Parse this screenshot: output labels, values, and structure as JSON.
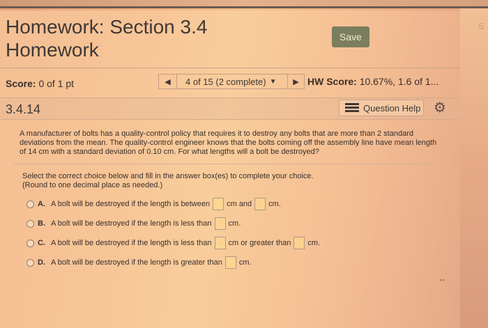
{
  "header": {
    "title": "Homework: Section 3.4 Homework",
    "save_label": "Save",
    "side_text": "S"
  },
  "scorebar": {
    "score_label": "Score:",
    "score_value": "0 of 1 pt",
    "nav_prev_icon": "triangle-left-icon",
    "nav_next_icon": "triangle-right-icon",
    "progress": "4 of 15 (2 complete)",
    "hw_score_label": "HW Score:",
    "hw_score_value": "10.67%, 1.6 of 1..."
  },
  "question": {
    "number": "3.4.14",
    "help_label": "Question Help",
    "text": "A manufacturer of bolts has a quality-control policy that requires it to destroy any bolts that are more than 2 standard deviations from the mean. The quality-control engineer knows that the bolts coming off the assembly line have mean length of 14 cm with a standard deviation of 0.10 cm. For what lengths will a bolt be destroyed?",
    "instruction_1": "Select the correct choice below and fill in the answer box(es) to complete your choice.",
    "instruction_2": "(Round to one decimal place as needed.)"
  },
  "choices": [
    {
      "letter": "A.",
      "prefix": "A bolt will be destroyed if the length is between",
      "middle": "cm and",
      "suffix": "cm."
    },
    {
      "letter": "B.",
      "prefix": "A bolt will be destroyed if the length is less than",
      "suffix": "cm."
    },
    {
      "letter": "C.",
      "prefix": "A bolt will be destroyed if the length is less than",
      "middle": "cm or greater than",
      "suffix": "cm."
    },
    {
      "letter": "D.",
      "prefix": "A bolt will be destroyed if the length is greater than",
      "suffix": "cm."
    }
  ]
}
